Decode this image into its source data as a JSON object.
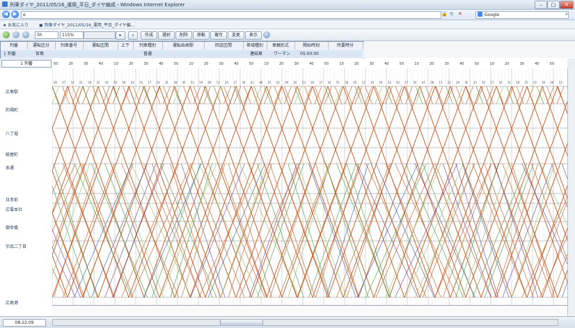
{
  "window": {
    "title": "列車ダイヤ_2011/05/16_運用_平日_ダイヤ編成 - Windows Internet Explorer",
    "minimize": "–",
    "maximize": "▢",
    "close": "✕"
  },
  "browser": {
    "address": "e",
    "search_provider": "Google",
    "search_placeholder": "",
    "favorites_label": "お気に入り",
    "tab_label": "列車ダイヤ_2011/05/16_運用_平日_ダイヤ編..."
  },
  "toolbar": {
    "interval_value": "5h",
    "zoom_value": "115%",
    "buttons": [
      "作成",
      "選択",
      "削除",
      "移動",
      "複写",
      "変更",
      "表示"
    ]
  },
  "header": {
    "columns": [
      "列番",
      "運転区分",
      "列車番号",
      "運転区間",
      "上下",
      "列車種別",
      "運転始発駅",
      "回送区間",
      "帯域種別",
      "車輌形式",
      "開始時刻",
      "所要時分"
    ],
    "row": {
      "number": "1 列番",
      "region": "宮島",
      "type": "普通",
      "formation": "連結車",
      "series": "ワーマン",
      "time": "05:00:00"
    }
  },
  "subheader": {
    "selector": "1 列番",
    "top_ticks": [
      "50",
      "20",
      "30",
      "40",
      "10",
      "20",
      "30",
      "40",
      "50",
      "10",
      "20",
      "30",
      "40",
      "50",
      "10",
      "20",
      "30",
      "40",
      "50",
      "10",
      "20",
      "30",
      "40",
      "50",
      "10",
      "20",
      "30",
      "40",
      "50",
      "10",
      "20",
      "30",
      "40",
      "50"
    ]
  },
  "stations": [
    "広島駅",
    "的場町",
    "八丁堀",
    "紙屋町",
    "本通",
    "日赤前",
    "広電本社",
    "御幸橋",
    "宇品二丁目",
    "広島港"
  ],
  "bottom": {
    "ticks": [
      "40",
      "35",
      "37",
      "4",
      "11",
      "17",
      "23",
      "3017",
      "44",
      "23",
      "4",
      "14",
      "17",
      "24",
      "28",
      "34",
      "4",
      "35",
      "38",
      "4",
      "12",
      "16",
      "25",
      "35",
      "48",
      "4",
      "24",
      "22",
      "46",
      "54",
      "4",
      "14",
      "24",
      "30"
    ],
    "clock": "08:22:09"
  },
  "colors": {
    "orange": "#c8561a",
    "green": "#3e9b3a",
    "purple": "#6b3a9e",
    "blue": "#2f57a8",
    "lightgreen": "#8fc46a",
    "grid": "#d9d9d9"
  }
}
